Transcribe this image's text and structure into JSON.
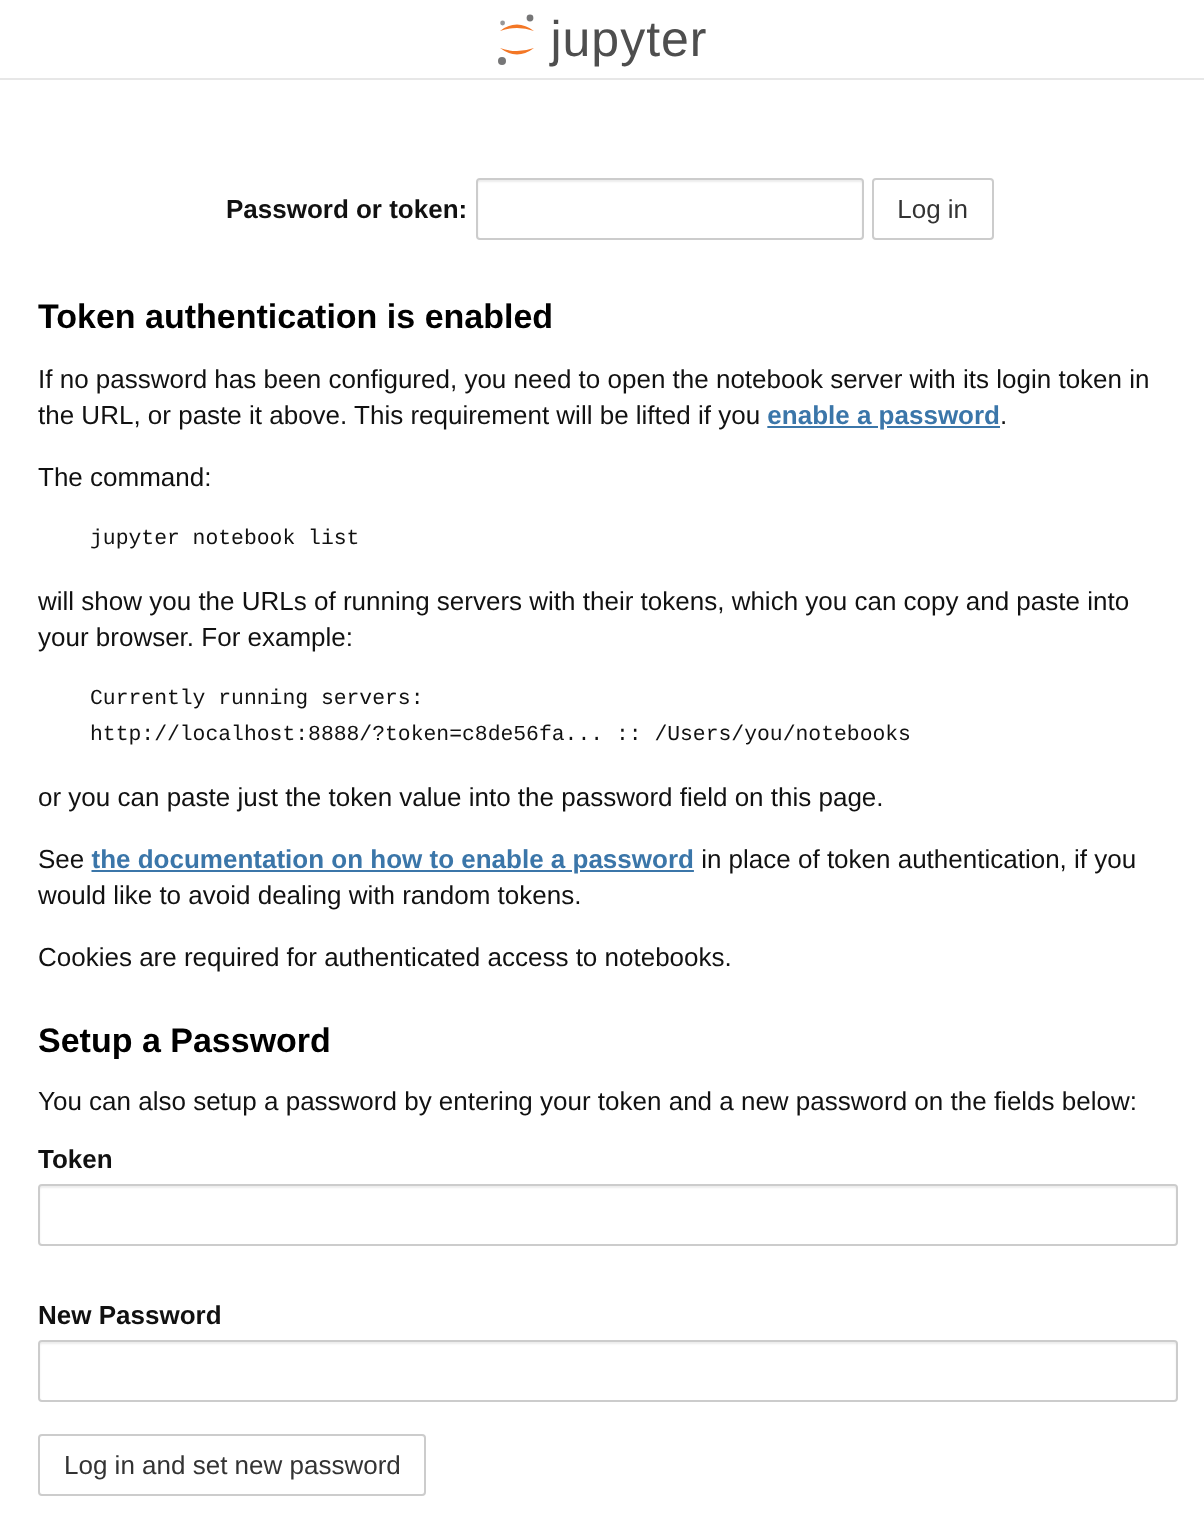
{
  "header": {
    "logo_text": "jupyter"
  },
  "login": {
    "label": "Password or token:",
    "button": "Log in"
  },
  "token_section": {
    "title": "Token authentication is enabled",
    "blocks": [
      {
        "kind": "text",
        "parts": [
          {
            "kind": "plain",
            "text": "If no password has been configured, you need to open the notebook server with its login token in the URL, or paste it above. This requirement will be lifted if you "
          },
          {
            "kind": "link",
            "text": "enable a password"
          },
          {
            "kind": "plain",
            "text": "."
          }
        ]
      },
      {
        "kind": "text",
        "parts": [
          {
            "kind": "plain",
            "text": "The command:"
          }
        ]
      },
      {
        "kind": "code",
        "lines": [
          "jupyter notebook list"
        ]
      },
      {
        "kind": "text",
        "parts": [
          {
            "kind": "plain",
            "text": "will show you the URLs of running servers with their tokens, which you can copy and paste into your browser. For example:"
          }
        ]
      },
      {
        "kind": "code",
        "lines": [
          "Currently running servers:",
          "http://localhost:8888/?token=c8de56fa... :: /Users/you/notebooks"
        ]
      },
      {
        "kind": "text",
        "parts": [
          {
            "kind": "plain",
            "text": "or you can paste just the token value into the password field on this page."
          }
        ]
      },
      {
        "kind": "text",
        "parts": [
          {
            "kind": "plain",
            "text": "See "
          },
          {
            "kind": "link",
            "text": "the documentation on how to enable a password"
          },
          {
            "kind": "plain",
            "text": " in place of token authentication, if you would like to avoid dealing with random tokens."
          }
        ]
      },
      {
        "kind": "text",
        "parts": [
          {
            "kind": "plain",
            "text": "Cookies are required for authenticated access to notebooks."
          }
        ]
      }
    ]
  },
  "setup_section": {
    "title": "Setup a Password",
    "intro": "You can also setup a password by entering your token and a new password on the fields below:",
    "fields": [
      {
        "label": "Token"
      },
      {
        "label": "New Password"
      }
    ],
    "button": "Log in and set new password"
  }
}
